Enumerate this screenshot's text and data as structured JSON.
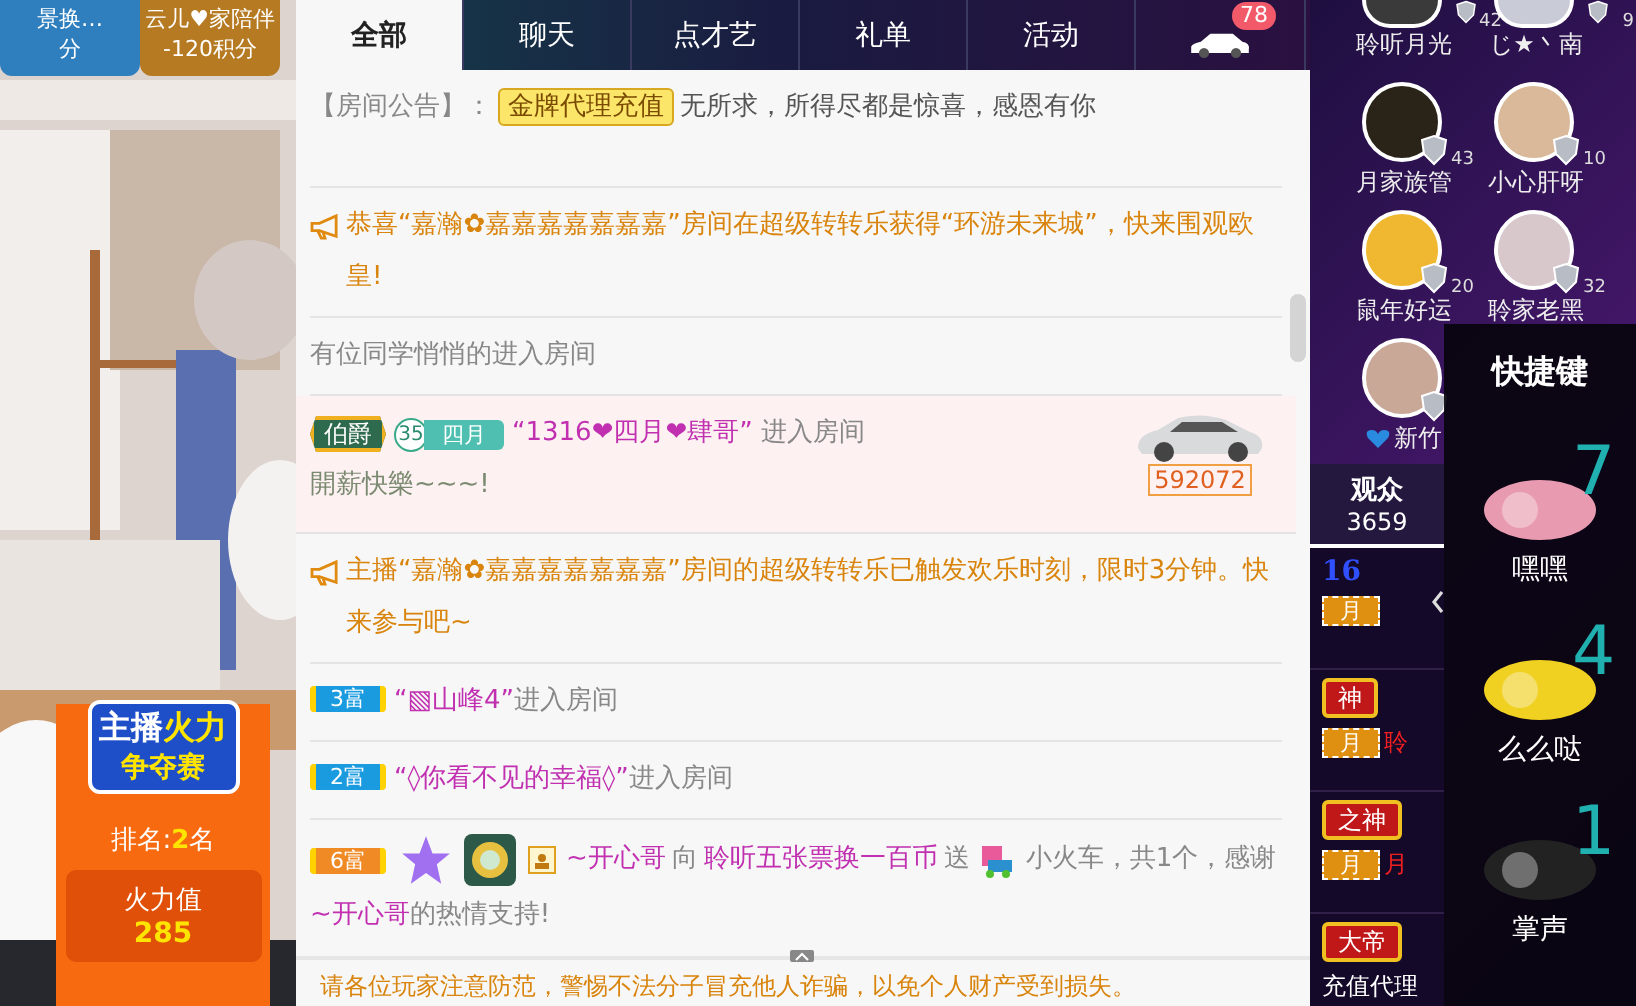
{
  "video": {
    "top_buttons": [
      {
        "lines": [
          "景换…",
          "分"
        ],
        "color": "#2f7fbf"
      },
      {
        "lines": [
          "云儿♥家陪伴",
          "-120积分"
        ],
        "color": "#b57a22"
      }
    ],
    "contest": {
      "title_a": "主播",
      "title_b": "火力",
      "subtitle": "争夺赛",
      "rank_label": "排名:",
      "rank": "2",
      "rank_unit": "名",
      "score_label": "火力值",
      "score": "285"
    }
  },
  "chat": {
    "tabs": [
      {
        "label": "全部",
        "selected": true
      },
      {
        "label": "聊天",
        "selected": false
      },
      {
        "label": "点才艺",
        "selected": false
      },
      {
        "label": "礼单",
        "selected": false
      },
      {
        "label": "活动",
        "selected": false
      }
    ],
    "car_badge": "78",
    "messages": [
      {
        "kind": "notice",
        "label": "【房间公告】：",
        "tag": "金牌代理充值",
        "text": "无所求，所得尽都是惊喜，感恩有你"
      },
      {
        "kind": "broadcast",
        "text": "恭喜“嘉瀚✿嘉嘉嘉嘉嘉嘉嘉”房间在超级转转乐获得“环游未来城”，快来围观欧皇!"
      },
      {
        "kind": "plain",
        "text": "有位同学悄悄的进入房间"
      },
      {
        "kind": "vip_entry",
        "rank": "伯爵",
        "level": "35",
        "fan": "四月",
        "name": "“1316❤四月❤肆哥”",
        "action": "进入房间",
        "greeting": "開薪快樂~~~!",
        "car_id": "592072"
      },
      {
        "kind": "broadcast",
        "text": "主播“嘉瀚✿嘉嘉嘉嘉嘉嘉嘉”房间的超级转转乐已触发欢乐时刻，限时3分钟。快来参与吧~"
      },
      {
        "kind": "entry",
        "wealth": "3富",
        "color": "#1a9be0",
        "name": "“▧山峰4”",
        "action": "进入房间"
      },
      {
        "kind": "entry",
        "wealth": "2富",
        "color": "#1a9be0",
        "name": "“◊你看不见的幸福◊”",
        "action": "进入房间"
      },
      {
        "kind": "gift",
        "wealth": "6富",
        "color": "#f08a24",
        "sender": "~开心哥",
        "to": "向",
        "receiver": "聆听五张票换一百币",
        "send": "送",
        "gift": "小火车，共1个，感谢",
        "thanked": "~开心哥",
        "end": "的热情支持!"
      }
    ],
    "footer": "请各位玩家注意防范，警惕不法分子冒充他人诈骗，以免个人财产受到损失。"
  },
  "guardians": [
    {
      "name": "聆听月光",
      "rank": "42",
      "heart": false,
      "color": "#3a3a3a"
    },
    {
      "name": "じ★丶南",
      "rank": "9",
      "heart": false,
      "color": "#c9ccd6"
    },
    {
      "name": "月家族管",
      "rank": "43",
      "heart": false,
      "color": "#2a2418"
    },
    {
      "name": "小心肝呀",
      "rank": "10",
      "heart": false,
      "color": "#d9b99a"
    },
    {
      "name": "鼠年好运",
      "rank": "20",
      "heart": false,
      "color": "#f0b830"
    },
    {
      "name": "聆家老黑",
      "rank": "32",
      "heart": false,
      "color": "#d8c8cc"
    },
    {
      "name": "新竹",
      "heart": true,
      "color": "#c9a898"
    }
  ],
  "shortcut": "快捷键",
  "audience_tab": {
    "label": "观众",
    "count": "3659",
    "selected": true
  },
  "audience": [
    {
      "kind": "level",
      "badge_text": "16",
      "fan": "月"
    },
    {
      "kind": "title",
      "badge_text": "神",
      "fan": "月",
      "name": "聆"
    },
    {
      "kind": "title",
      "badge_text": "之神",
      "fan": "月",
      "name": "月"
    },
    {
      "kind": "title",
      "badge_text": "大帝",
      "name": "充值代理"
    }
  ],
  "gifts": [
    {
      "count": "7",
      "name": "嘿嘿",
      "color": "#e89ab0"
    },
    {
      "count": "4",
      "name": "么么哒",
      "color": "#f0d020"
    },
    {
      "count": "1",
      "name": "掌声",
      "color": "#222222"
    }
  ]
}
